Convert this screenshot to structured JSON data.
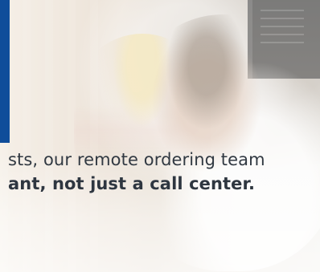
{
  "image": {
    "accent_color": "#0f4d9a",
    "text_color": "#313942"
  },
  "caption": {
    "line1": "sts, our remote ordering team",
    "line2": "ant, not just a call center."
  }
}
